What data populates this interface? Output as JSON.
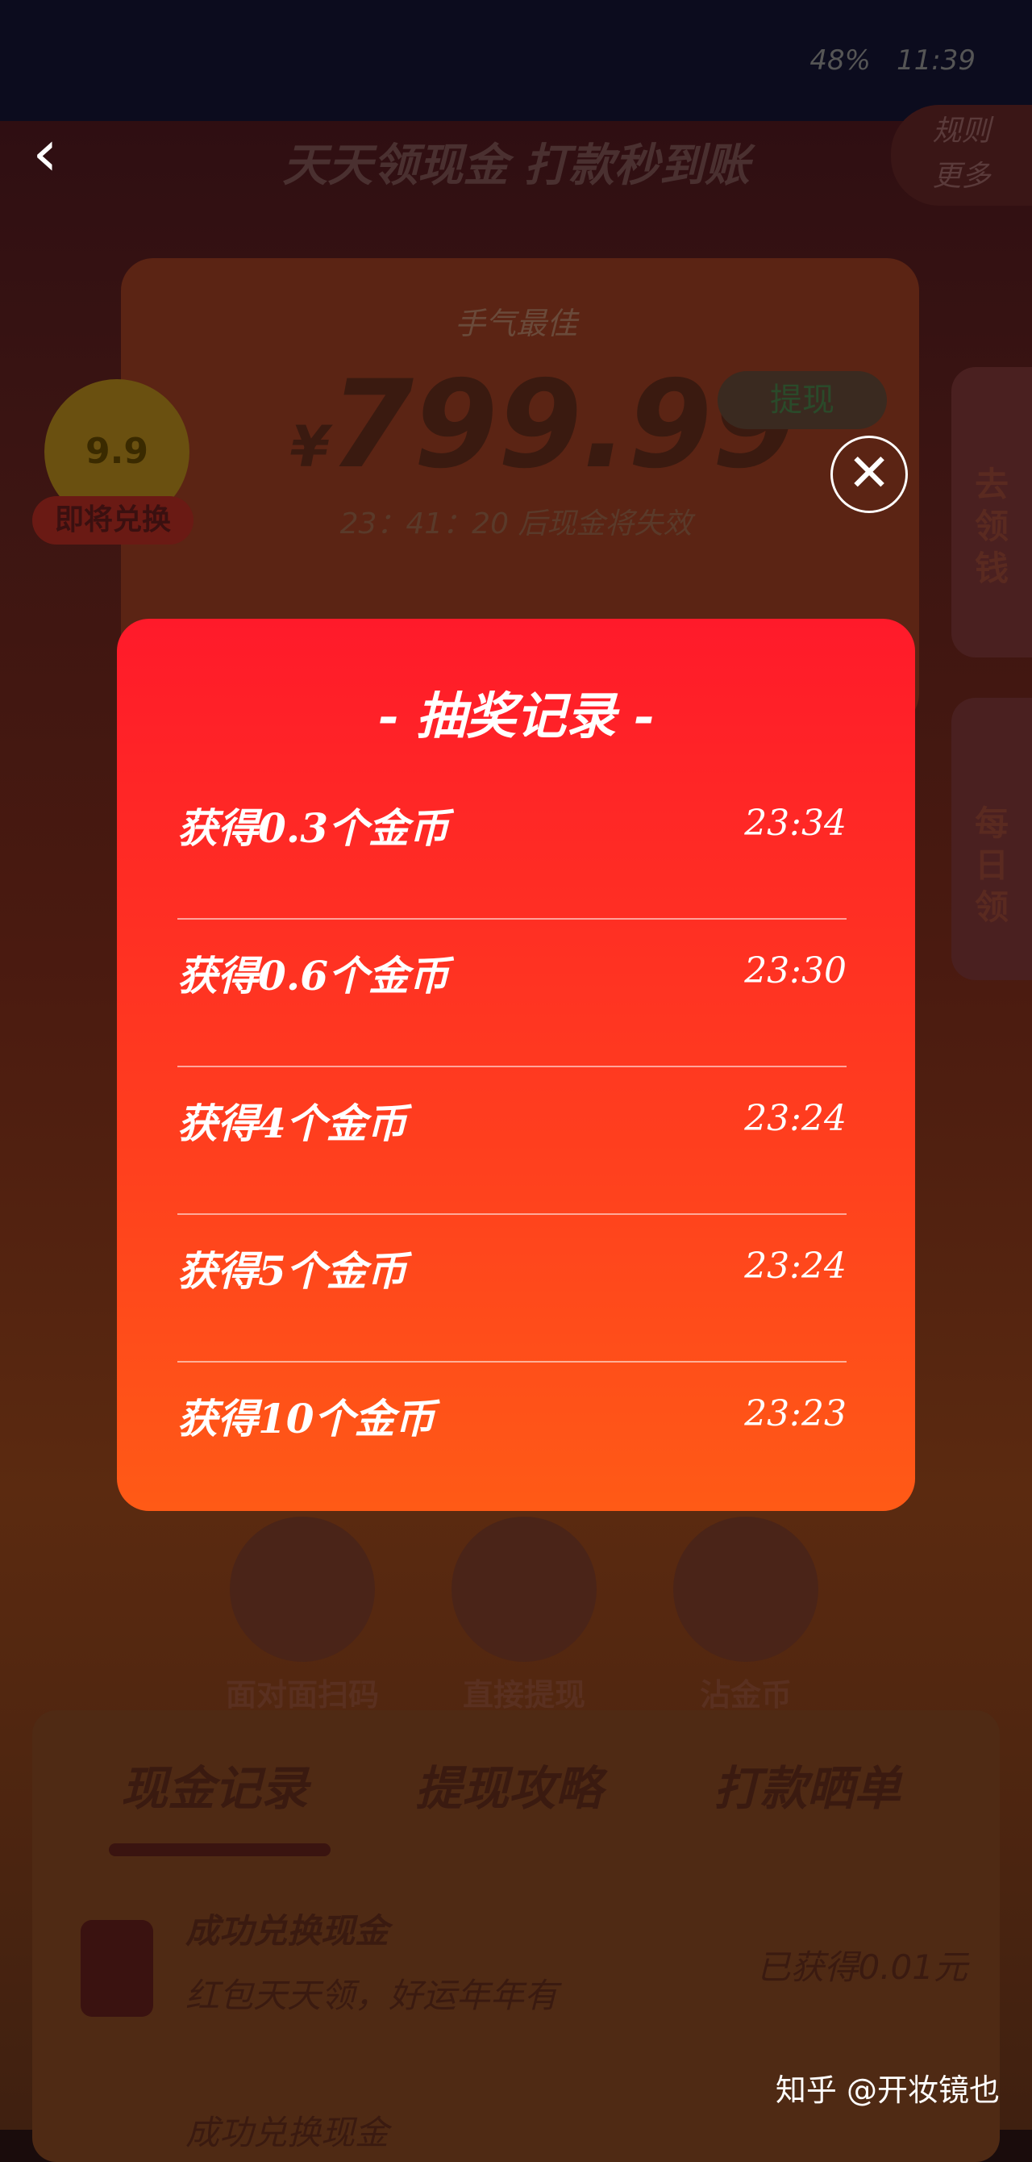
{
  "background": {
    "page_title": "天天领现金 打款秒到账",
    "rules_badge": [
      "规则",
      "更多"
    ],
    "luck_label": "手气最佳",
    "currency": "¥",
    "amount": "799.99",
    "withdraw_label": "提现",
    "expire_text": "23：41：20 后现金将失效",
    "coin_badge": "9.9",
    "exchange_label": "即将兑换",
    "side_tab_1": [
      "去",
      "领",
      "钱"
    ],
    "side_tab_2": [
      "每",
      "日",
      "领"
    ],
    "actions": [
      "面对面扫码",
      "直接提现",
      "沾金币"
    ],
    "tabs": [
      "现金记录",
      "提现攻略",
      "打款晒单"
    ],
    "record": {
      "title": "成功兑换现金",
      "subtitle": "红包天天领，好运年年有",
      "amount": "已获得0.01元",
      "title_2": "成功兑换现金"
    },
    "watermark": "知乎 @开妆镜也",
    "status_time": "11:39",
    "status_battery": "48%"
  },
  "modal": {
    "title": "- 抽奖记录 -",
    "records": [
      {
        "label": "获得0.3个金币",
        "time": "23:34"
      },
      {
        "label": "获得0.6个金币",
        "time": "23:30"
      },
      {
        "label": "获得4个金币",
        "time": "23:24"
      },
      {
        "label": "获得5个金币",
        "time": "23:24"
      },
      {
        "label": "获得10个金币",
        "time": "23:23"
      }
    ],
    "close_symbol": "✕"
  },
  "colors": {
    "modal_top": "#ff1a2a",
    "modal_bottom": "#ff5a16"
  }
}
